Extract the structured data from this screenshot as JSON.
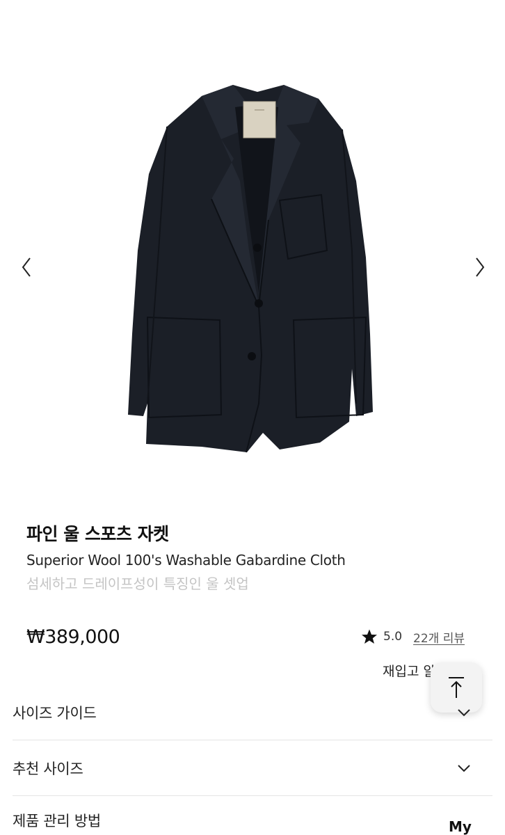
{
  "gallery": {
    "prev_icon": "chevron-left-icon",
    "next_icon": "chevron-right-icon",
    "image_alt": "product-image-jacket"
  },
  "product": {
    "title": "파인 울 스포츠 자켓",
    "subtitle": "Superior Wool 100's Washable Gabardine Cloth",
    "tagline": "섬세하고 드레이프성이 특징인 울 셋업",
    "price": "₩389,000"
  },
  "rating": {
    "icon": "star-icon",
    "value": "5.0",
    "review_link": "22개 리뷰"
  },
  "restock": {
    "label": "재입고 알림 신청"
  },
  "scroll_top": {
    "icon": "arrow-up-to-top-icon"
  },
  "accordion": [
    {
      "label": "사이즈 가이드"
    },
    {
      "label": "추천 사이즈"
    },
    {
      "label": "제품 관리 방법"
    }
  ],
  "floating": {
    "my_label": "My"
  },
  "colors": {
    "jacket": "#1b1f27",
    "tagline": "#c4c4c4",
    "divider": "#e4e4e4"
  }
}
